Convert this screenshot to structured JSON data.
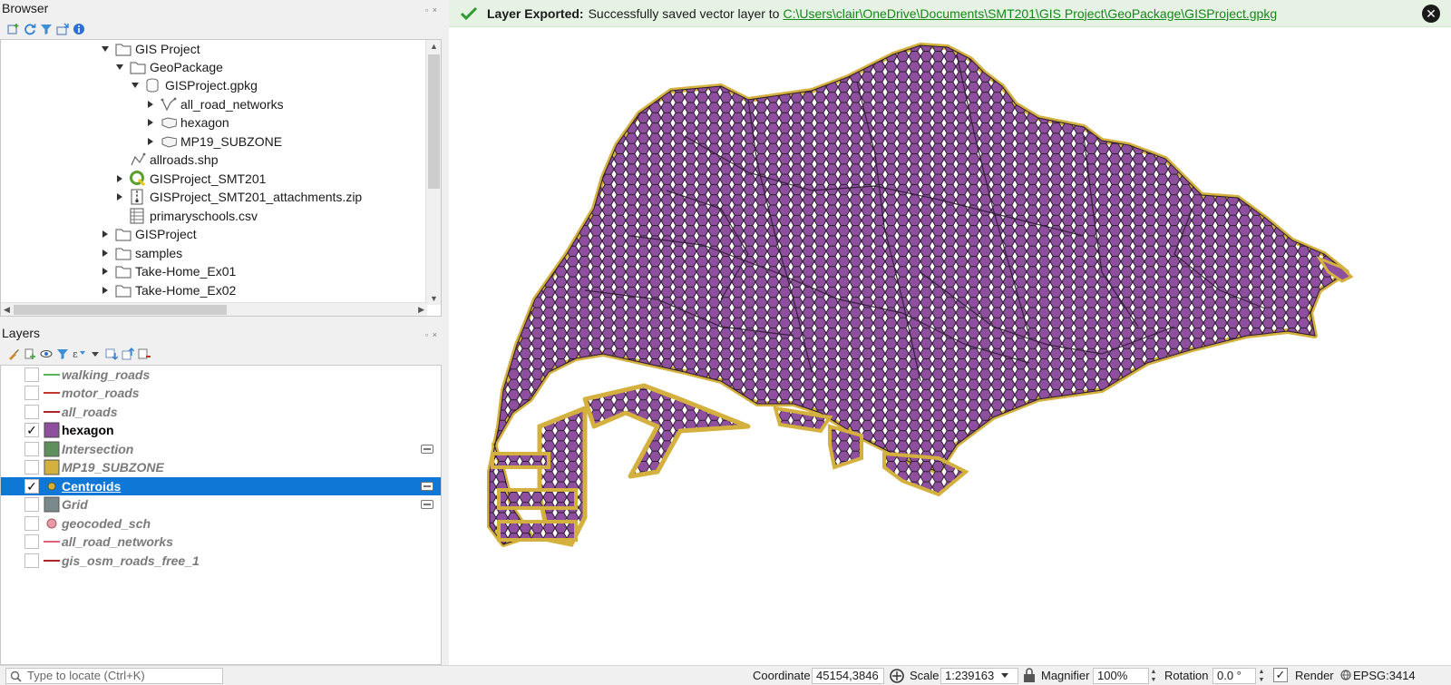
{
  "browser": {
    "title": "Browser",
    "items": [
      {
        "label": "GIS Project",
        "expanded": true,
        "icon": "folder-icon"
      },
      {
        "label": "GeoPackage",
        "expanded": true,
        "icon": "folder-icon"
      },
      {
        "label": "GISProject.gpkg",
        "expanded": true,
        "icon": "database-icon"
      },
      {
        "label": "all_road_networks",
        "expanded": false,
        "icon": "line-layer-icon"
      },
      {
        "label": "hexagon",
        "expanded": false,
        "icon": "polygon-layer-icon"
      },
      {
        "label": "MP19_SUBZONE",
        "expanded": false,
        "icon": "polygon-layer-icon"
      },
      {
        "label": "allroads.shp",
        "icon": "line-layer-icon"
      },
      {
        "label": "GISProject_SMT201",
        "expanded": false,
        "icon": "qgis-project-icon"
      },
      {
        "label": "GISProject_SMT201_attachments.zip",
        "expanded": false,
        "icon": "zip-icon"
      },
      {
        "label": "primaryschools.csv",
        "icon": "table-icon"
      },
      {
        "label": "GISProject",
        "expanded": false,
        "icon": "folder-icon"
      },
      {
        "label": "samples",
        "expanded": false,
        "icon": "folder-icon"
      },
      {
        "label": "Take-Home_Ex01",
        "expanded": false,
        "icon": "folder-icon"
      },
      {
        "label": "Take-Home_Ex02",
        "expanded": false,
        "icon": "folder-icon"
      }
    ]
  },
  "layers": {
    "title": "Layers",
    "items": [
      {
        "name": "walking_roads",
        "checked": false,
        "symbol": "line",
        "color": "#5bb35b"
      },
      {
        "name": "motor_roads",
        "checked": false,
        "symbol": "line",
        "color": "#c0392b"
      },
      {
        "name": "all_roads",
        "checked": false,
        "symbol": "line",
        "color": "#b22222"
      },
      {
        "name": "hexagon",
        "checked": true,
        "symbol": "fill",
        "color": "#8e4f9e"
      },
      {
        "name": "Intersection",
        "checked": false,
        "symbol": "fill",
        "color": "#5f8f5a"
      },
      {
        "name": "MP19_SUBZONE",
        "checked": false,
        "symbol": "fill",
        "color": "#d4b13f"
      },
      {
        "name": "Centroids",
        "checked": true,
        "symbol": "point",
        "color": "#d4b13f",
        "selected": true
      },
      {
        "name": "Grid",
        "checked": false,
        "symbol": "fill",
        "color": "#7a8a8c"
      },
      {
        "name": "geocoded_sch",
        "checked": false,
        "symbol": "point",
        "color": "#e89aa6"
      },
      {
        "name": "all_road_networks",
        "checked": false,
        "symbol": "line",
        "color": "#e0607a"
      },
      {
        "name": "gis_osm_roads_free_1",
        "checked": false,
        "symbol": "line",
        "color": "#b22222"
      }
    ]
  },
  "message": {
    "title": "Layer Exported:",
    "text": "Successfully saved vector layer to",
    "path": "C:\\Users\\clair\\OneDrive\\Documents\\SMT201\\GIS Project\\GeoPackage\\GISProject.gpkg",
    "close_symbol": "✕"
  },
  "status": {
    "locate_placeholder": "Type to locate (Ctrl+K)",
    "coordinate_label": "Coordinate",
    "coordinate_value": "45154,3846",
    "scale_label": "Scale",
    "scale_value": "1:239163",
    "magnifier_label": "Magnifier",
    "magnifier_value": "100%",
    "rotation_label": "Rotation",
    "rotation_value": "0.0 °",
    "render_label": "Render",
    "render_checked": true,
    "crs": "EPSG:3414"
  },
  "colors": {
    "hexagon_fill": "#8e4f9e",
    "hexagon_outline": "#2a1a2e",
    "centroid_fill": "#d4b13f",
    "message_bg": "#e6f3e4",
    "selection": "#0f78d7"
  }
}
